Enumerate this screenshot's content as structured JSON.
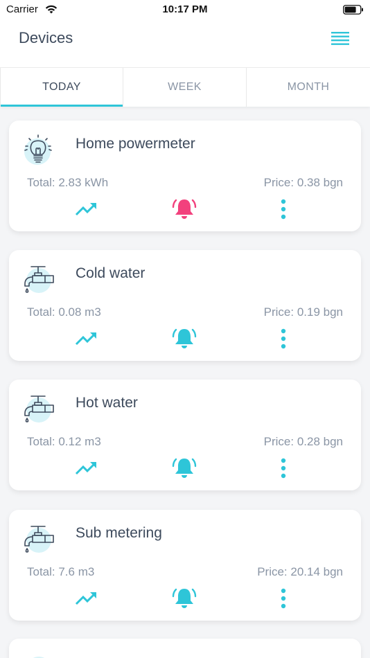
{
  "status_bar": {
    "carrier": "Carrier",
    "time": "10:17 PM"
  },
  "header": {
    "title": "Devices",
    "menu_icon": "hamburger-menu-icon"
  },
  "tabs": [
    {
      "label": "TODAY",
      "active": true
    },
    {
      "label": "WEEK",
      "active": false
    },
    {
      "label": "MONTH",
      "active": false
    }
  ],
  "colors": {
    "accent": "#2ec5d8",
    "alert": "#f2417d",
    "icon_bg": "#d8f3f8",
    "text": "#3d4a5c",
    "muted": "#8a95a5"
  },
  "devices": [
    {
      "name": "Home powermeter",
      "icon": "lightbulb-icon",
      "total": "Total: 2.83 kWh",
      "price": "Price: 0.38 bgn",
      "alert_active": true
    },
    {
      "name": "Cold water",
      "icon": "water-tap-icon",
      "total": "Total: 0.08 m3",
      "price": "Price: 0.19 bgn",
      "alert_active": false
    },
    {
      "name": "Hot water",
      "icon": "water-tap-icon",
      "total": "Total: 0.12 m3",
      "price": "Price: 0.28 bgn",
      "alert_active": false
    },
    {
      "name": "Sub metering",
      "icon": "water-tap-icon",
      "total": "Total: 7.6 m3",
      "price": "Price: 20.14 bgn",
      "alert_active": false
    }
  ]
}
